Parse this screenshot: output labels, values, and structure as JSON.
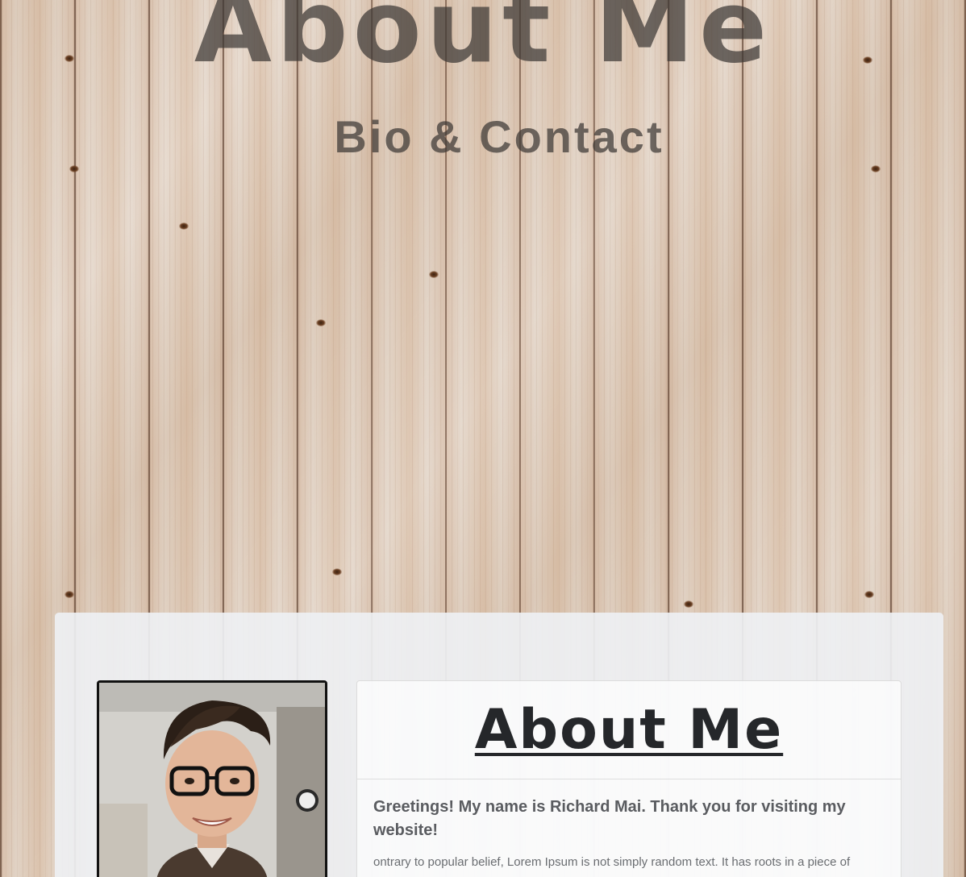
{
  "hero": {
    "title": "About Me",
    "subtitle": "Bio & Contact"
  },
  "about_card": {
    "title": "About Me",
    "greeting": "Greetings! My name is Richard Mai. Thank you for visiting my website!",
    "bio": "ontrary to popular belief, Lorem Ipsum is not simply random text. It has roots in a piece of"
  },
  "profile_photo": {
    "alt": "Richard Mai"
  },
  "colors": {
    "panel": "#eef0f3",
    "heading": "#25272a",
    "body_text": "#5a5c60"
  }
}
